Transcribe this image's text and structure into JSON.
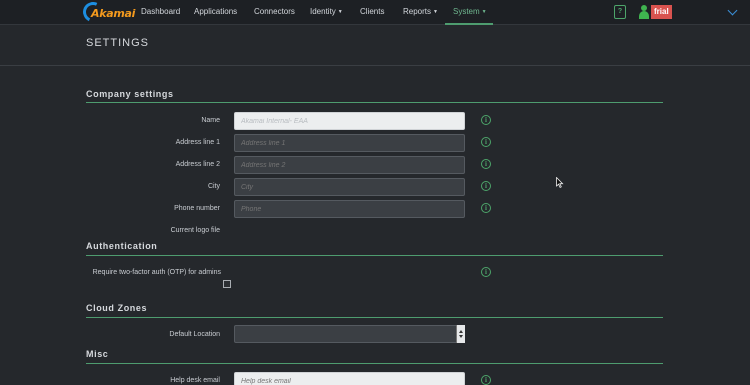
{
  "nav": {
    "logo_text": "Akamai",
    "items": [
      {
        "label": "Dashboard"
      },
      {
        "label": "Applications"
      },
      {
        "label": "Connectors"
      },
      {
        "label": "Identity",
        "dropdown": true
      },
      {
        "label": "Clients"
      },
      {
        "label": "Reports",
        "dropdown": true
      },
      {
        "label": "System",
        "dropdown": true,
        "active": true
      }
    ],
    "caret": "▼",
    "help_icon": "?",
    "user_name": "frial"
  },
  "page": {
    "title": "SETTINGS"
  },
  "sections": {
    "company": {
      "title": "Company settings",
      "name": {
        "label": "Name",
        "value": "Akamai Internal- EAA"
      },
      "address1": {
        "label": "Address line 1",
        "placeholder": "Address line 1"
      },
      "address2": {
        "label": "Address line 2",
        "placeholder": "Address line 2"
      },
      "city": {
        "label": "City",
        "placeholder": "City"
      },
      "phone": {
        "label": "Phone number",
        "placeholder": "Phone"
      },
      "logo": {
        "label": "Current logo file"
      }
    },
    "authentication": {
      "title": "Authentication",
      "otp": {
        "label": "Require two-factor auth (OTP) for admins",
        "checked": false
      }
    },
    "cloud_zones": {
      "title": "Cloud Zones",
      "default_location": {
        "label": "Default Location",
        "value": ""
      }
    },
    "misc": {
      "title": "Misc",
      "help_desk_email": {
        "label": "Help desk email",
        "placeholder": "Help desk email"
      }
    }
  },
  "info_glyph": "i",
  "colors": {
    "accent": "#4e9c6f",
    "nav_active": "#6fb78f",
    "logo_orange": "#f39a1e",
    "logo_blue": "#1d8ee0",
    "user_badge": "#d9534f",
    "background": "#25282c"
  }
}
